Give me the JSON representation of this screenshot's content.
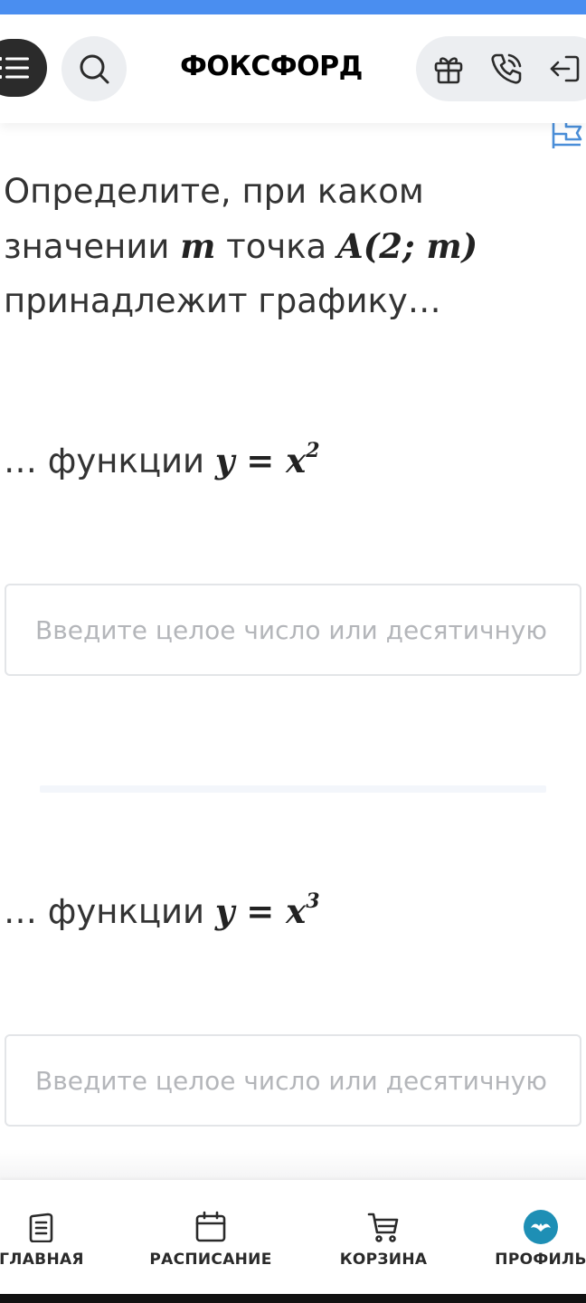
{
  "colors": {
    "status_strip": "#4a8ef0",
    "menu_button": "#2b2b2b",
    "pill_background": "#eceef1",
    "profile_avatar": "#1e8fb5",
    "flag_icon": "#4a8ed8"
  },
  "header": {
    "logo": "ФОКСФОРД",
    "menu_icon": "menu-list-icon",
    "search_icon": "search-icon",
    "actions": [
      "gift-icon",
      "phone-icon",
      "login-icon"
    ]
  },
  "flag_icon": "report-flag-icon",
  "question": {
    "prefix": "Определите, при каком значении",
    "var_m": "m",
    "middle": "точка",
    "point": "A(2; m)",
    "suffix": "принадлежит графику…"
  },
  "parts": [
    {
      "lead": "… функции",
      "formula": "y = x",
      "power": "2",
      "placeholder": "Введите целое число или десятичную дробь"
    },
    {
      "lead": "… функции",
      "formula": "y = x",
      "power": "3",
      "placeholder": "Введите целое число или десятичную дробь"
    }
  ],
  "tabbar": {
    "items": [
      {
        "label": "ГЛАВНАЯ",
        "icon": "document-icon"
      },
      {
        "label": "РАСПИСАНИЕ",
        "icon": "calendar-icon"
      },
      {
        "label": "КОРЗИНА",
        "icon": "cart-icon"
      },
      {
        "label": "ПРОФИЛЬ",
        "icon": "profile-avatar-icon"
      }
    ]
  }
}
